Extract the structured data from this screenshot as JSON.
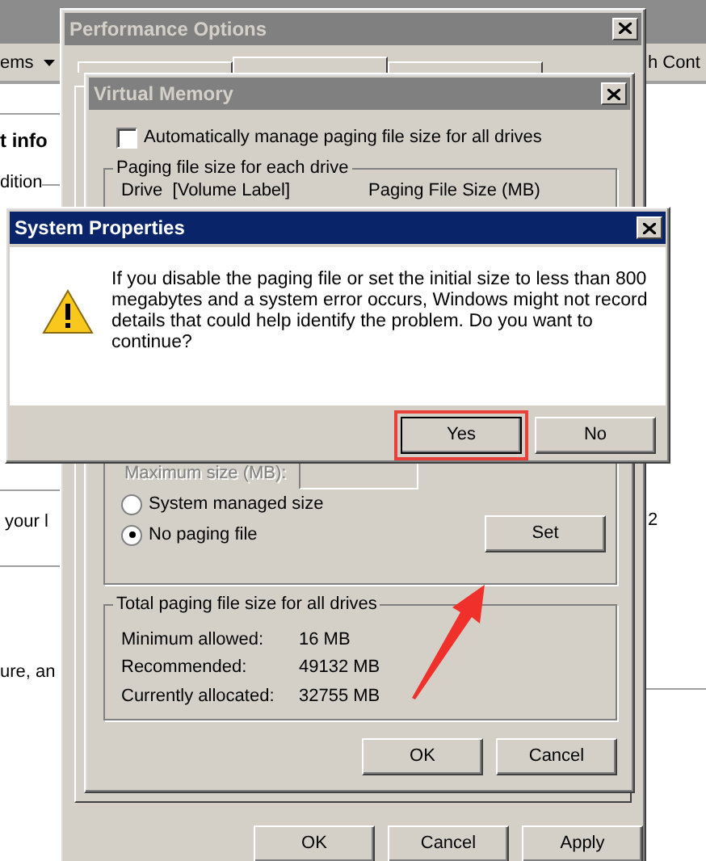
{
  "background_window": {
    "left_texts": [
      {
        "kind": "menu",
        "text": "ems"
      },
      {
        "kind": "heading",
        "text": "t info"
      },
      {
        "kind": "group",
        "text": "dition"
      },
      {
        "kind": "plain",
        "text": "your l"
      },
      {
        "kind": "plain",
        "text": "ure, an"
      }
    ],
    "right_texts": [
      "h Cont",
      "2"
    ]
  },
  "performance_options": {
    "title": "Performance Options",
    "tabs": [
      {
        "selected": false
      },
      {
        "selected": true
      },
      {
        "selected": false
      }
    ],
    "buttons": [
      "OK",
      "Cancel",
      "Apply"
    ]
  },
  "virtual_memory": {
    "title": "Virtual Memory",
    "auto_manage": {
      "label": "Automatically manage paging file size for all drives",
      "checked": false
    },
    "drive_group": {
      "title": "Paging file size for each drive",
      "columns": [
        "Drive  [Volume Label]",
        "Paging File Size (MB)"
      ],
      "maximum_size": {
        "label": "Maximum size (MB):",
        "disabled": true
      },
      "options": [
        {
          "label": "System managed size",
          "selected": false
        },
        {
          "label": "No paging file",
          "selected": true
        }
      ],
      "set_button": "Set"
    },
    "total_group": {
      "title": "Total paging file size for all drives",
      "rows": [
        {
          "label": "Minimum allowed:",
          "value": "16 MB"
        },
        {
          "label": "Recommended:",
          "value": "49132 MB"
        },
        {
          "label": "Currently allocated:",
          "value": "32755 MB"
        }
      ]
    },
    "buttons": [
      "OK",
      "Cancel"
    ]
  },
  "dialog": {
    "title": "System Properties",
    "message": "If you disable the paging file or set the initial size to less than 800 megabytes and a system error occurs, Windows might not record details that could help identify the problem. Do you want to continue?",
    "buttons": [
      {
        "label": "Yes",
        "highlighted": true
      },
      {
        "label": "No",
        "highlighted": false
      }
    ]
  }
}
